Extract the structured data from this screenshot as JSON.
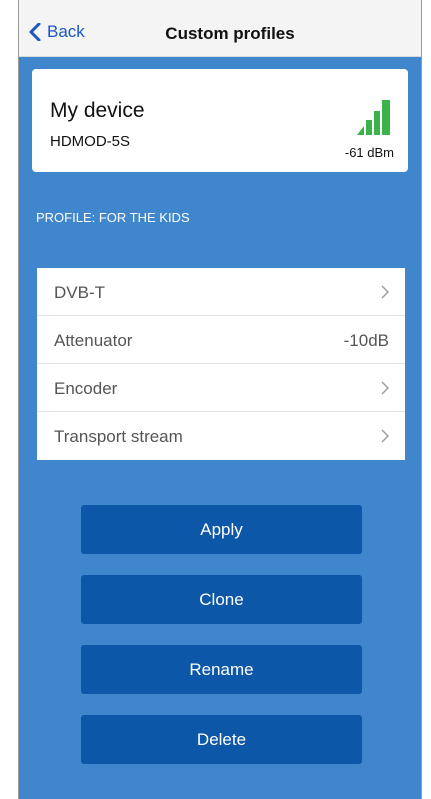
{
  "nav": {
    "back_label": "Back",
    "title": "Custom profiles"
  },
  "device": {
    "name": "My device",
    "model": "HDMOD-5S",
    "signal": "-61 dBm",
    "signal_bars_filled": 4,
    "signal_color": "#3cb34a"
  },
  "profile": {
    "label": "PROFILE: FOR THE KIDS"
  },
  "settings": [
    {
      "label": "DVB-T",
      "value": "",
      "chevron": true
    },
    {
      "label": "Attenuator",
      "value": "-10dB",
      "chevron": false
    },
    {
      "label": "Encoder",
      "value": "",
      "chevron": true
    },
    {
      "label": "Transport stream",
      "value": "",
      "chevron": true
    }
  ],
  "actions": {
    "apply": "Apply",
    "clone": "Clone",
    "rename": "Rename",
    "delete": "Delete"
  },
  "colors": {
    "accent_blue": "#1a56c4",
    "background_blue": "#3f86cc",
    "button_blue": "#0d57a8"
  }
}
